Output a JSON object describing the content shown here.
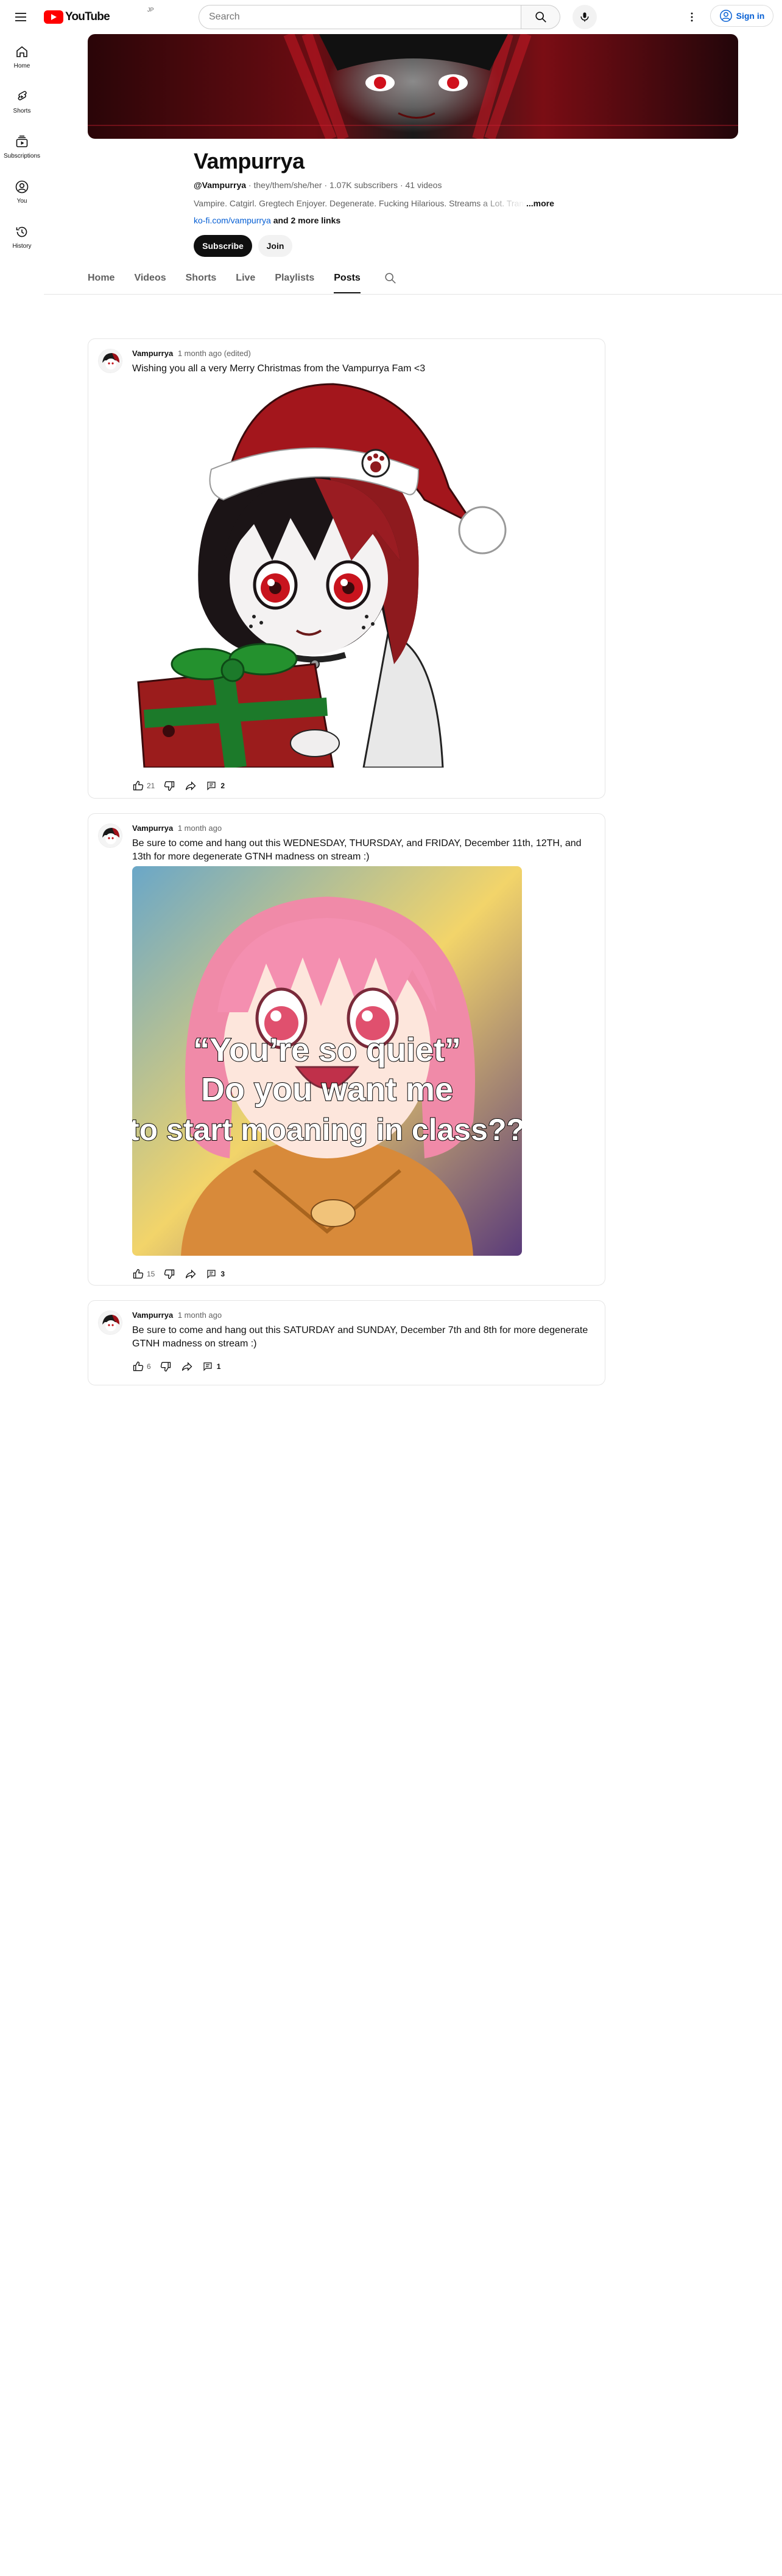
{
  "masthead": {
    "logo_text": "YouTube",
    "logo_sup": "JP",
    "search_placeholder": "Search",
    "signin_label": "Sign in"
  },
  "sidebar": {
    "items": [
      {
        "label": "Home",
        "icon": "home-icon"
      },
      {
        "label": "Shorts",
        "icon": "shorts-icon"
      },
      {
        "label": "Subscriptions",
        "icon": "subscriptions-icon"
      },
      {
        "label": "You",
        "icon": "you-icon"
      },
      {
        "label": "History",
        "icon": "history-icon"
      }
    ]
  },
  "channel": {
    "name": "Vampurrya",
    "handle": "@Vampurrya",
    "pronouns": "they/them/she/her",
    "subscribers": "1.07K subscribers",
    "videos": "41 videos",
    "description": "Vampire. Catgirl. Gregtech Enjoyer. Degenerate. Fucking Hilarious. Streams a Lot. Trans",
    "more_label": "...more",
    "link_text": "ko-fi.com/vampurrya",
    "more_links": "and 2 more links",
    "subscribe_label": "Subscribe",
    "join_label": "Join"
  },
  "tabs": [
    {
      "label": "Home",
      "active": false
    },
    {
      "label": "Videos",
      "active": false
    },
    {
      "label": "Shorts",
      "active": false
    },
    {
      "label": "Live",
      "active": false
    },
    {
      "label": "Playlists",
      "active": false
    },
    {
      "label": "Posts",
      "active": true
    }
  ],
  "posts": [
    {
      "author": "Vampurrya",
      "time": "1 month ago (edited)",
      "text": "Wishing you all a very Merry Christmas from the Vampurrya Fam <3",
      "likes": "21",
      "comments": "2"
    },
    {
      "author": "Vampurrya",
      "time": "1 month ago",
      "text": "Be sure to come and hang out this WEDNESDAY, THURSDAY, and FRIDAY, December 11th, 12TH,  and 13th for more degenerate GTNH madness on stream :)",
      "image_caption_lines": [
        "“You’re so quiet”",
        "Do you want me",
        "to start moaning in class??"
      ],
      "likes": "15",
      "comments": "3"
    },
    {
      "author": "Vampurrya",
      "time": "1 month ago",
      "text": "Be sure to come and hang out this SATURDAY and SUNDAY, December 7th and 8th for more degenerate GTNH madness on stream :)",
      "likes": "6",
      "comments": "1"
    }
  ],
  "colors": {
    "brand_red": "#ff0000",
    "link_blue": "#065fd4",
    "text_primary": "#0f0f0f",
    "text_secondary": "#606060"
  }
}
